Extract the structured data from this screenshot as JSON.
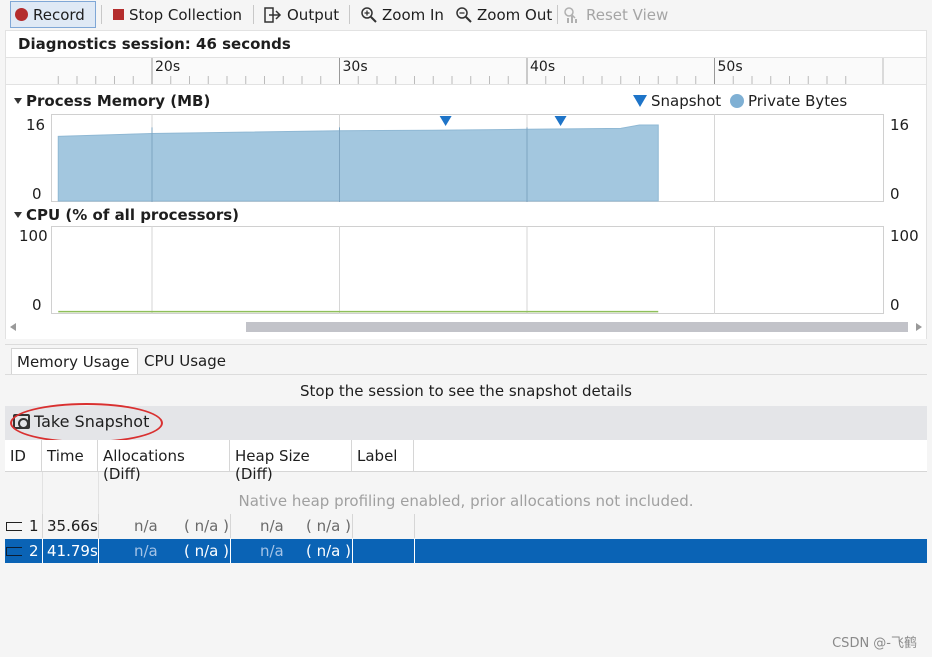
{
  "toolbar": {
    "record": "Record",
    "stop": "Stop Collection",
    "output": "Output",
    "zoom_in": "Zoom In",
    "zoom_out": "Zoom Out",
    "reset_view": "Reset View"
  },
  "session": {
    "title": "Diagnostics session: 46 seconds"
  },
  "ruler": {
    "ticks": [
      "20s",
      "30s",
      "40s",
      "50s"
    ]
  },
  "memory_chart": {
    "title": "Process Memory (MB)",
    "legend_snapshot": "Snapshot",
    "legend_private": "Private Bytes",
    "y_top": "16",
    "y_bottom": "0"
  },
  "cpu_chart": {
    "title": "CPU (% of all processors)",
    "y_top": "100",
    "y_bottom": "0"
  },
  "tabs": {
    "memory": "Memory Usage",
    "cpu": "CPU Usage"
  },
  "message": "Stop the session to see the snapshot details",
  "snapshot_button": "Take Snapshot",
  "table": {
    "columns": [
      "ID",
      "Time",
      "Allocations (Diff)",
      "Heap Size (Diff)",
      "Label"
    ],
    "note": "Native heap profiling enabled, prior allocations not included.",
    "rows": [
      {
        "id": "1",
        "time": "35.66s",
        "alloc": "n/a",
        "alloc_diff": "( n/a )",
        "heap": "n/a",
        "heap_diff": "( n/a )",
        "selected": false
      },
      {
        "id": "2",
        "time": "41.79s",
        "alloc": "n/a",
        "alloc_diff": "( n/a )",
        "heap": "n/a",
        "heap_diff": "( n/a )",
        "selected": true
      }
    ]
  },
  "watermark": "CSDN @-飞鹤",
  "chart_data": [
    {
      "type": "area",
      "title": "Process Memory (MB)",
      "x_unit": "seconds",
      "ylim": [
        0,
        16
      ],
      "series": [
        {
          "name": "Private Bytes",
          "color": "#a3c7df",
          "x": [
            15,
            20,
            25,
            30,
            35,
            40,
            45,
            46,
            47
          ],
          "y": [
            13.6,
            14.2,
            14.5,
            14.8,
            14.9,
            15.1,
            15.3,
            16.0,
            16.0
          ]
        }
      ],
      "snapshots": [
        35.66,
        41.79
      ]
    },
    {
      "type": "line",
      "title": "CPU (% of all processors)",
      "ylim": [
        0,
        100
      ],
      "series": [
        {
          "name": "CPU",
          "color": "#8fbf5a",
          "x": [
            15,
            47
          ],
          "y": [
            0.5,
            0.5
          ]
        }
      ]
    }
  ]
}
